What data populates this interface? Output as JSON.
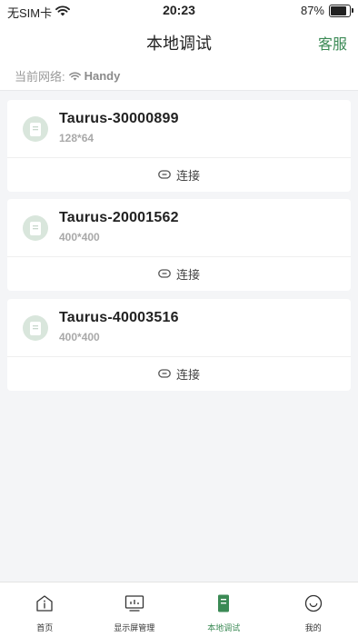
{
  "status_bar": {
    "carrier": "无SIM卡",
    "time": "20:23",
    "battery_percent": "87%",
    "battery_level": 0.87
  },
  "nav": {
    "title": "本地调试",
    "right_action": "客服"
  },
  "network": {
    "label": "当前网络:",
    "ssid": "Handy",
    "icon": "wifi-icon"
  },
  "devices": [
    {
      "name": "Taurus-30000899",
      "resolution": "128*64",
      "action": "连接"
    },
    {
      "name": "Taurus-20001562",
      "resolution": "400*400",
      "action": "连接"
    },
    {
      "name": "Taurus-40003516",
      "resolution": "400*400",
      "action": "连接"
    }
  ],
  "tabs": [
    {
      "label": "首页",
      "icon": "home-icon",
      "active": false
    },
    {
      "label": "显示屏管理",
      "icon": "display-icon",
      "active": false
    },
    {
      "label": "本地调试",
      "icon": "device-icon",
      "active": true
    },
    {
      "label": "我的",
      "icon": "smile-icon",
      "active": false
    }
  ],
  "colors": {
    "accent": "#3b8a55",
    "background": "#f4f5f7",
    "icon_bg": "#d9e6dc"
  }
}
